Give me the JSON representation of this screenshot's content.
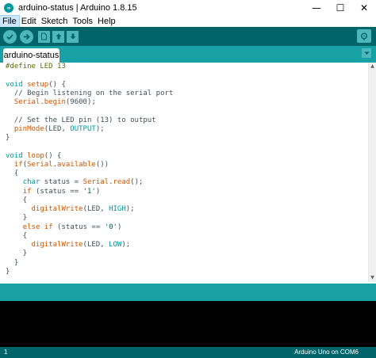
{
  "window": {
    "title": "arduino-status | Arduino 1.8.15",
    "icon_text": "∞",
    "controls": {
      "minimize": "—",
      "maximize": "☐",
      "close": "✕"
    }
  },
  "menu": [
    {
      "label": "File",
      "active": true
    },
    {
      "label": "Edit",
      "active": false
    },
    {
      "label": "Sketch",
      "active": false
    },
    {
      "label": "Tools",
      "active": false
    },
    {
      "label": "Help",
      "active": false
    }
  ],
  "toolbar": {
    "verify_icon": "checkmark-icon",
    "upload_icon": "arrow-right-icon",
    "new_icon": "new-file-icon",
    "open_icon": "arrow-up-icon",
    "save_icon": "arrow-down-icon",
    "serial_monitor_icon": "magnifier-icon"
  },
  "tabs": [
    {
      "label": "arduino-status"
    }
  ],
  "code_lines": [
    [
      {
        "t": "#define LED 13",
        "c": "pp"
      }
    ],
    [],
    [
      {
        "t": "void",
        "c": "kw"
      },
      {
        "t": " "
      },
      {
        "t": "setup",
        "c": "fn"
      },
      {
        "t": "() {"
      }
    ],
    [
      {
        "t": "  // Begin listening on the serial port",
        "c": "cm"
      }
    ],
    [
      {
        "t": "  "
      },
      {
        "t": "Serial",
        "c": "fn"
      },
      {
        "t": "."
      },
      {
        "t": "begin",
        "c": "fn"
      },
      {
        "t": "(9600);"
      }
    ],
    [],
    [
      {
        "t": "  // Set the LED pin (13) to output",
        "c": "cm"
      }
    ],
    [
      {
        "t": "  "
      },
      {
        "t": "pinMode",
        "c": "fn"
      },
      {
        "t": "(LED, "
      },
      {
        "t": "OUTPUT",
        "c": "kw"
      },
      {
        "t": ");"
      }
    ],
    [
      {
        "t": "}"
      }
    ],
    [],
    [
      {
        "t": "void",
        "c": "kw"
      },
      {
        "t": " "
      },
      {
        "t": "loop",
        "c": "fn"
      },
      {
        "t": "() {"
      }
    ],
    [
      {
        "t": "  "
      },
      {
        "t": "if",
        "c": "fn"
      },
      {
        "t": "("
      },
      {
        "t": "Serial",
        "c": "fn"
      },
      {
        "t": "."
      },
      {
        "t": "available",
        "c": "fn"
      },
      {
        "t": "())"
      }
    ],
    [
      {
        "t": "  {"
      }
    ],
    [
      {
        "t": "    "
      },
      {
        "t": "char",
        "c": "kw"
      },
      {
        "t": " status = "
      },
      {
        "t": "Serial",
        "c": "fn"
      },
      {
        "t": "."
      },
      {
        "t": "read",
        "c": "fn"
      },
      {
        "t": "();"
      }
    ],
    [
      {
        "t": "    "
      },
      {
        "t": "if",
        "c": "fn"
      },
      {
        "t": " (status == "
      },
      {
        "t": "'1'",
        "c": "str"
      },
      {
        "t": ")"
      }
    ],
    [
      {
        "t": "    {"
      }
    ],
    [
      {
        "t": "      "
      },
      {
        "t": "digitalWrite",
        "c": "fn"
      },
      {
        "t": "(LED, "
      },
      {
        "t": "HIGH",
        "c": "kw"
      },
      {
        "t": ");"
      }
    ],
    [
      {
        "t": "    }"
      }
    ],
    [
      {
        "t": "    "
      },
      {
        "t": "else",
        "c": "fn"
      },
      {
        "t": " "
      },
      {
        "t": "if",
        "c": "fn"
      },
      {
        "t": " (status == "
      },
      {
        "t": "'0'",
        "c": "str"
      },
      {
        "t": ")"
      }
    ],
    [
      {
        "t": "    {"
      }
    ],
    [
      {
        "t": "      "
      },
      {
        "t": "digitalWrite",
        "c": "fn"
      },
      {
        "t": "(LED, "
      },
      {
        "t": "LOW",
        "c": "kw"
      },
      {
        "t": ");"
      }
    ],
    [
      {
        "t": "    }"
      }
    ],
    [
      {
        "t": "  }"
      }
    ],
    [
      {
        "t": "}"
      }
    ]
  ],
  "status": {
    "line_number": "1",
    "board": "Arduino Uno on COM6"
  },
  "colors": {
    "toolbar_bg": "#006468",
    "tab_strip_bg": "#17a1a5",
    "button_bg": "#4db7bb",
    "console_bg": "#000000",
    "keyword": "#00979c",
    "function": "#d35400"
  }
}
